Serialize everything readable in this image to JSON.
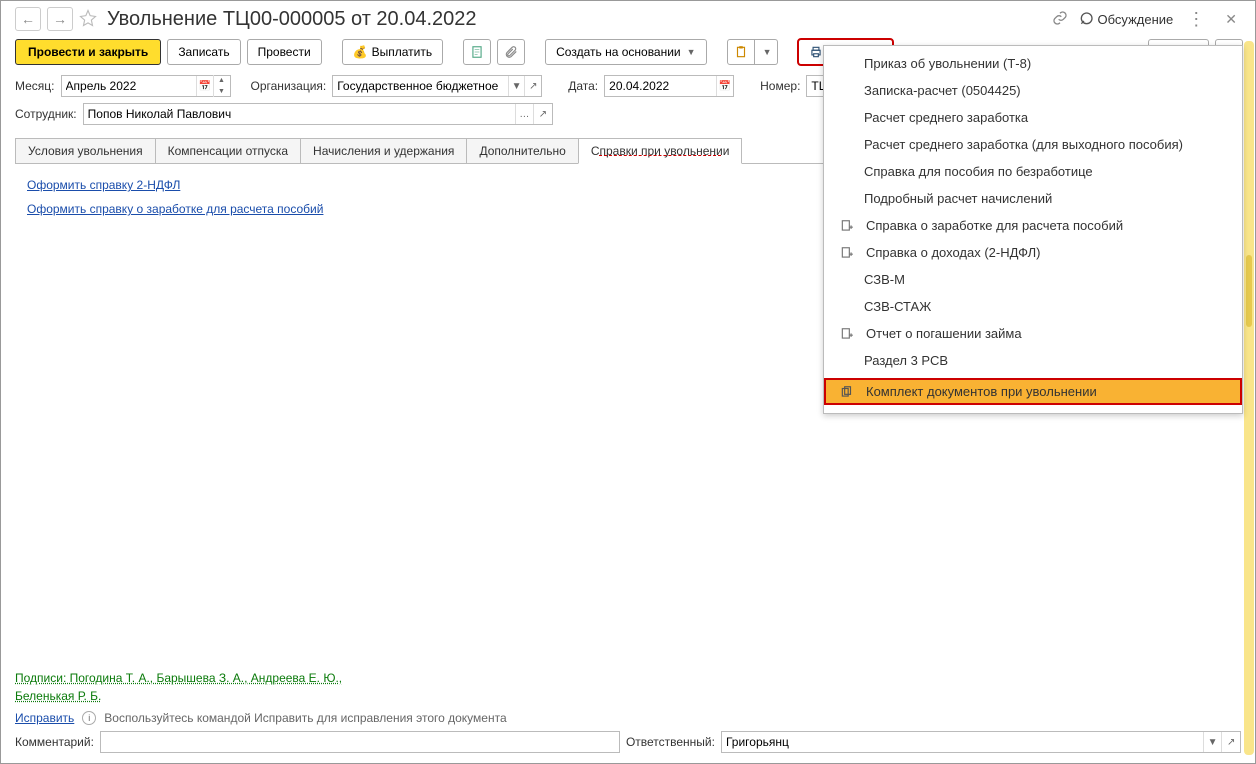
{
  "header": {
    "title": "Увольнение ТЦ00-000005 от 20.04.2022",
    "discuss": "Обсуждение"
  },
  "toolbar": {
    "post_close": "Провести и закрыть",
    "save": "Записать",
    "post": "Провести",
    "pay": "Выплатить",
    "create_based": "Создать на основании",
    "print": "Печать",
    "more": "Еще",
    "help": "?"
  },
  "fields": {
    "month_label": "Месяц:",
    "month_value": "Апрель 2022",
    "org_label": "Организация:",
    "org_value": "Государственное бюджетное",
    "date_label": "Дата:",
    "date_value": "20.04.2022",
    "number_label": "Номер:",
    "number_value": "ТЦ",
    "employee_label": "Сотрудник:",
    "employee_value": "Попов Николай Павлович"
  },
  "tabs": {
    "t0": "Условия увольнения",
    "t1": "Компенсации отпуска",
    "t2": "Начисления и удержания",
    "t3": "Дополнительно",
    "t4": "Справки при увольнении"
  },
  "tab_content": {
    "link1": "Оформить справку 2-НДФЛ",
    "link2": "Оформить справку о заработке для расчета пособий"
  },
  "print_menu": {
    "i0": "Приказ об увольнении (Т-8)",
    "i1": "Записка-расчет (0504425)",
    "i2": "Расчет среднего заработка",
    "i3": "Расчет среднего заработка (для выходного пособия)",
    "i4": "Справка для пособия по безработице",
    "i5": "Подробный расчет начислений",
    "i6": "Справка о заработке для расчета пособий",
    "i7": "Справка о доходах (2-НДФЛ)",
    "i8": "СЗВ-М",
    "i9": "СЗВ-СТАЖ",
    "i10": "Отчет о погашении займа",
    "i11": "Раздел 3 РСВ",
    "i12": "Комплект документов при увольнении"
  },
  "footer": {
    "sign_line1": "Подписи: Погодина Т. А., Барышева З. А., Андреева Е. Ю.,",
    "sign_line2": "Беленькая Р. Б.",
    "fix": "Исправить",
    "fix_hint": "Воспользуйтесь командой Исправить для исправления этого документа",
    "comment_label": "Комментарий:",
    "comment_value": "",
    "resp_label": "Ответственный:",
    "resp_value": "Григорьянц"
  }
}
